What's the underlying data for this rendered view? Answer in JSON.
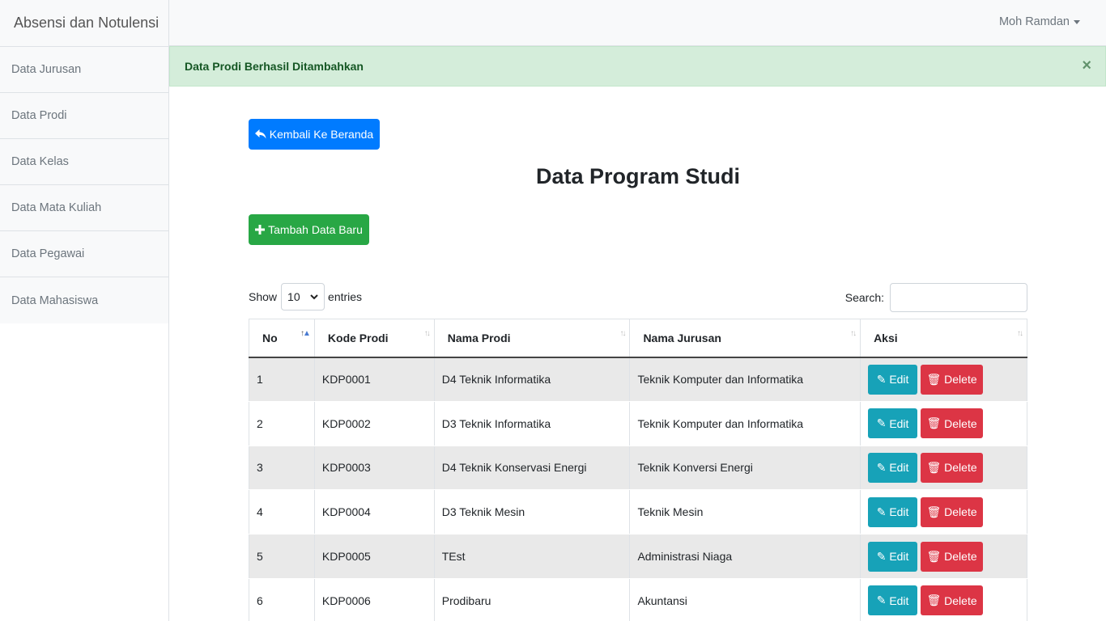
{
  "app": {
    "title": "Absensi dan Notulensi"
  },
  "sidebar": {
    "items": [
      {
        "label": "Data Jurusan"
      },
      {
        "label": "Data Prodi"
      },
      {
        "label": "Data Kelas"
      },
      {
        "label": "Data Mata Kuliah"
      },
      {
        "label": "Data Pegawai"
      },
      {
        "label": "Data Mahasiswa"
      }
    ]
  },
  "topbar": {
    "user": "Moh Ramdan"
  },
  "alert": {
    "message": "Data Prodi Berhasil Ditambahkan",
    "close": "×"
  },
  "main": {
    "back_label": "Kembali Ke Beranda",
    "title": "Data Program Studi",
    "add_label": "Tambah Data Baru",
    "show_label": "Show",
    "entries_value": "10",
    "entries_label": "entries",
    "search_label": "Search:",
    "search_value": ""
  },
  "table": {
    "headers": [
      "No",
      "Kode Prodi",
      "Nama Prodi",
      "Nama Jurusan",
      "Aksi"
    ],
    "rows": [
      {
        "no": "1",
        "kode": "KDP0001",
        "nama": "D4 Teknik Informatika",
        "jurusan": "Teknik Komputer dan Informatika"
      },
      {
        "no": "2",
        "kode": "KDP0002",
        "nama": "D3 Teknik Informatika",
        "jurusan": "Teknik Komputer dan Informatika"
      },
      {
        "no": "3",
        "kode": "KDP0003",
        "nama": "D4 Teknik Konservasi Energi",
        "jurusan": "Teknik Konversi Energi"
      },
      {
        "no": "4",
        "kode": "KDP0004",
        "nama": "D3 Teknik Mesin",
        "jurusan": "Teknik Mesin"
      },
      {
        "no": "5",
        "kode": "KDP0005",
        "nama": "TEst",
        "jurusan": "Administrasi Niaga"
      },
      {
        "no": "6",
        "kode": "KDP0006",
        "nama": "Prodibaru",
        "jurusan": "Akuntansi"
      }
    ],
    "edit_label": "Edit",
    "delete_label": "Delete"
  },
  "colors": {
    "primary": "#007bff",
    "success": "#28a745",
    "info": "#17a2b8",
    "danger": "#dc3545",
    "alert_bg": "#d4edda"
  }
}
